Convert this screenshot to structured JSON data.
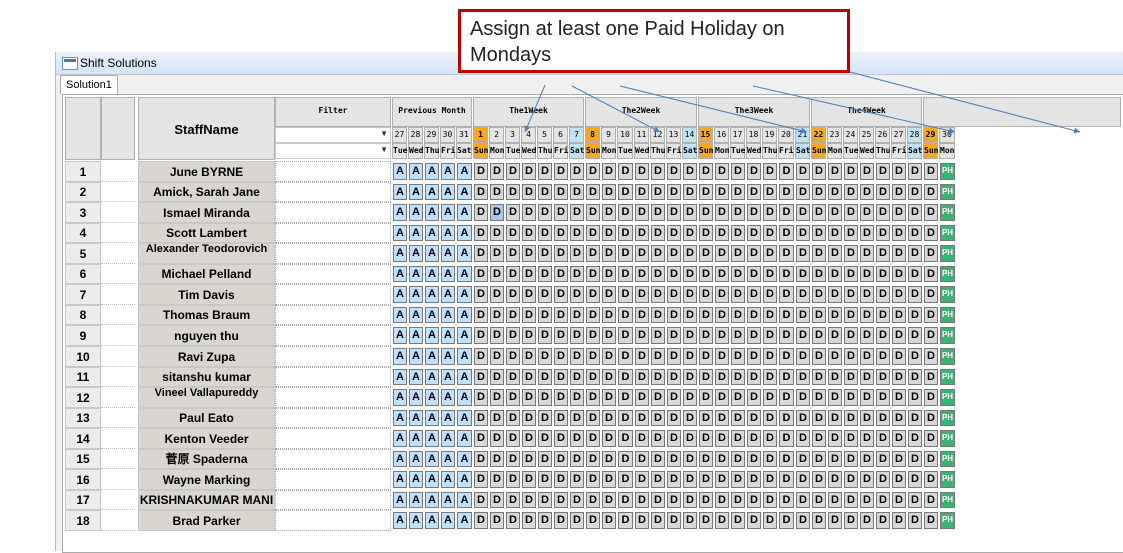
{
  "window": {
    "title": "Shift Solutions",
    "tab": "Solution1"
  },
  "header": {
    "staff_name": "StaffName",
    "filter": "Filter",
    "groups": [
      "Previous Month",
      "The1Week",
      "The2Week",
      "The3Week",
      "The4Week"
    ],
    "days": [
      "27",
      "28",
      "29",
      "30",
      "31",
      "1",
      "2",
      "3",
      "4",
      "5",
      "6",
      "7",
      "8",
      "9",
      "10",
      "11",
      "12",
      "13",
      "14",
      "15",
      "16",
      "17",
      "18",
      "19",
      "20",
      "21",
      "22",
      "23",
      "24",
      "25",
      "26",
      "27",
      "28",
      "29",
      "30"
    ],
    "weekdays": [
      "Tue",
      "Wed",
      "Thu",
      "Fri",
      "Sat",
      "Sun",
      "Mon",
      "Tue",
      "Wed",
      "Thu",
      "Fri",
      "Sat",
      "Sun",
      "Mon",
      "Tue",
      "Wed",
      "Thu",
      "Fri",
      "Sat",
      "Sun",
      "Mon",
      "Tue",
      "Wed",
      "Thu",
      "Fri",
      "Sat",
      "Sun",
      "Mon",
      "Tue",
      "Wed",
      "Thu",
      "Fri",
      "Sat",
      "Sun",
      "Mon"
    ]
  },
  "rows": [
    {
      "num": "1",
      "name": "June BYRNE"
    },
    {
      "num": "2",
      "name": "Amick, Sarah Jane"
    },
    {
      "num": "3",
      "name": "Ismael Miranda"
    },
    {
      "num": "4",
      "name": "Scott Lambert"
    },
    {
      "num": "5",
      "name": "Alexander Teodorovich"
    },
    {
      "num": "6",
      "name": "Michael Pelland"
    },
    {
      "num": "7",
      "name": "Tim Davis"
    },
    {
      "num": "8",
      "name": "Thomas Braum"
    },
    {
      "num": "9",
      "name": "nguyen thu"
    },
    {
      "num": "10",
      "name": "Ravi Zupa"
    },
    {
      "num": "11",
      "name": "sitanshu kumar"
    },
    {
      "num": "12",
      "name": "Vineel Vallapureddy"
    },
    {
      "num": "13",
      "name": "Paul Eato"
    },
    {
      "num": "14",
      "name": "Kenton Veeder"
    },
    {
      "num": "15",
      "name": "菅原 Spaderna"
    },
    {
      "num": "16",
      "name": "Wayne Marking"
    },
    {
      "num": "17",
      "name": "KRISHNAKUMAR MANI"
    },
    {
      "num": "18",
      "name": "Brad Parker"
    }
  ],
  "shift_codes": {
    "prev": "A",
    "work": "D",
    "holiday": "PH"
  },
  "callout": "Assign at least one Paid Holiday on Mondays",
  "colors": {
    "sunday": "#f7a823",
    "saturday": "#bfe3f5",
    "prev_cell": "#bfe0ff",
    "work_cell": "#d8d8d8",
    "holiday_cell": "#3cb371",
    "callout_border": "#c00000"
  }
}
